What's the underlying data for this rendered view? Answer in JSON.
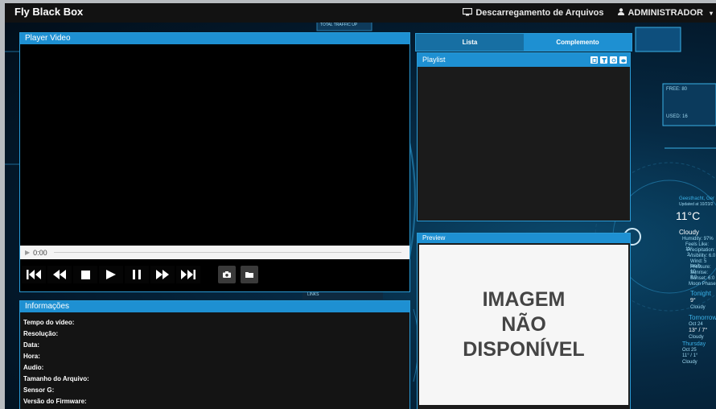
{
  "app": {
    "title": "Fly Black Box"
  },
  "nav": {
    "downloads_label": "Descarregamento de Arquivos",
    "user_label": "ADMINISTRADOR"
  },
  "player": {
    "title": "Player Video",
    "time": "0:00"
  },
  "info": {
    "title": "Informações",
    "fields": [
      "Tempo do vídeo:",
      "Resolução:",
      "Data:",
      "Hora:",
      "Audio:",
      "Tamanho do Arquivo:",
      "Sensor G:",
      "Versão do Firmware:"
    ]
  },
  "tabs": {
    "list_label": "Lista",
    "complement_label": "Complemento"
  },
  "playlist": {
    "title": "Playlist"
  },
  "preview": {
    "title": "Preview",
    "unavailable_line1": "IMAGEM",
    "unavailable_line2": "NÃO",
    "unavailable_line3": "DISPONÍVEL"
  },
  "background_widget": {
    "location": "Geesthacht, Ger",
    "updated": "Updated at 10/23/2",
    "temp": "11°C",
    "condition": "Cloudy",
    "humidity": "Humidity: 97%",
    "feels": "Feels Like: 11°",
    "precip": "Precipitation: 2",
    "visibility": "Visibility: 6.0",
    "wind": "Wind: 5 km/h",
    "pressure": "Pressure: 10",
    "sunrise": "Sunrise: 8:0",
    "sunset": "Sunset: 6:0",
    "moon": "Moon Phase",
    "tonight": "Tonight",
    "tonight_temp": "9°",
    "tonight_cond": "Cloudy",
    "tomorrow": "Tomorrow",
    "tomorrow_date": "Oct 24",
    "tomorrow_temp": "13° / 7°",
    "tomorrow_cond": "Cloudy",
    "thursday": "Thursday",
    "thursday_date": "Oct 25",
    "thursday_temp": "11° / 1°",
    "thursday_cond": "Cloudy",
    "free_label": "FREE: 80",
    "used_label": "USED: 16",
    "traffic_label": "TOTAL TRAFFIC UP",
    "links_label": "LINKS"
  },
  "colors": {
    "accent": "#1e90d2",
    "navbar": "#121212",
    "panel": "#1b1b1b"
  }
}
